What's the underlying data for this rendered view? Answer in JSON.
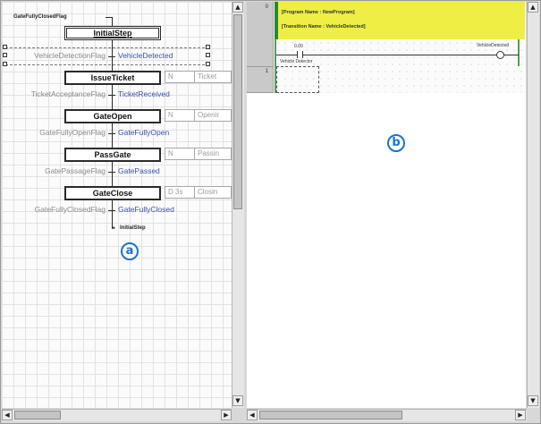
{
  "sfc": {
    "top_label": "GateFullyClosedFlag",
    "initial_step": "InitialStep",
    "steps": [
      "IssueTicket",
      "GateOpen",
      "PassGate",
      "GateClose"
    ],
    "actions": [
      {
        "q": "N",
        "name": "Ticket"
      },
      {
        "q": "N",
        "name": "Openir"
      },
      {
        "q": "N",
        "name": "Passin"
      },
      {
        "q": "D  3s",
        "name": "Closin"
      }
    ],
    "transitions": [
      {
        "condition": "VehicleDetectionFlag",
        "name": "VehicleDetected"
      },
      {
        "condition": "TicketAcceptanceFlag",
        "name": "TicketReceived"
      },
      {
        "condition": "GateFullyOpenFlag",
        "name": "GateFullyOpen"
      },
      {
        "condition": "GatePassageFlag",
        "name": "GatePassed"
      },
      {
        "condition": "GateFullyClosedFlag",
        "name": "GateFullyClosed"
      }
    ],
    "jump_target": "InitialStep",
    "badge": "a"
  },
  "ladder": {
    "line_numbers": [
      "0",
      "1"
    ],
    "comment_lines": [
      "[Program Name : NewProgram]",
      "[Transition Name : VehicleDetected]"
    ],
    "contact_label": "0.00",
    "contact_comment": "Vehicle Detector",
    "coil_label": "VehicleDetected",
    "badge": "b"
  },
  "scroll_icons": {
    "up": "▲",
    "down": "▼",
    "left": "◀",
    "right": "▶"
  },
  "colors": {
    "transition_text": "#3b4fa8",
    "comment_bg": "#eeee44",
    "badge": "#1a73c8"
  }
}
